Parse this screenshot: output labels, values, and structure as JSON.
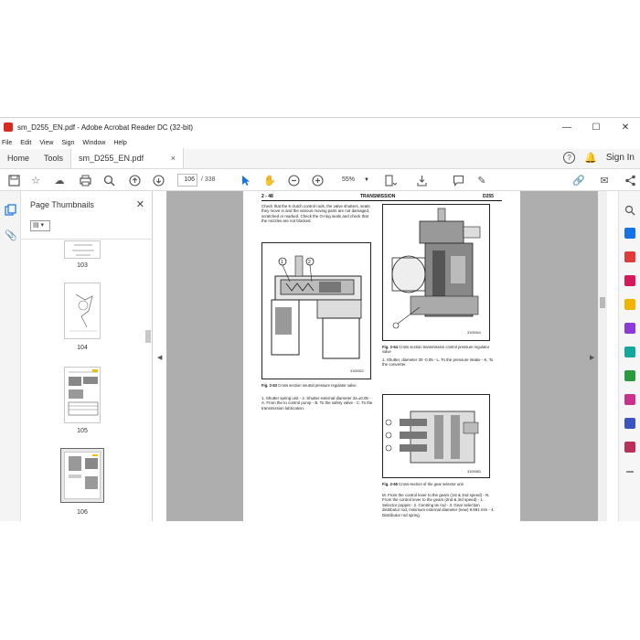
{
  "window": {
    "title": "sm_D255_EN.pdf - Adobe Acrobat Reader DC (32-bit)",
    "controls": [
      "—",
      "☐",
      "✕"
    ]
  },
  "menu": [
    "File",
    "Edit",
    "View",
    "Sign",
    "Window",
    "Help"
  ],
  "tabs": {
    "home": "Home",
    "tools": "Tools",
    "document": "sm_D255_EN.pdf",
    "close": "×",
    "help": "?",
    "sign_in": "Sign In"
  },
  "toolbar": {
    "page_current": "106",
    "page_total": "/ 338",
    "zoom": "55%"
  },
  "thumbnails": {
    "title": "Page Thumbnails",
    "close": "✕",
    "pages": [
      "103",
      "104",
      "105",
      "106"
    ]
  },
  "document": {
    "header_left": "2 - 48",
    "header_center": "TRANSMISSION",
    "header_right": "D255",
    "intro_text": "Check that the 5 clutch control rods, the valve shutters, seats they move in and the various moving parts are not damaged, scratched or marked. Check the O-ring seals and check that the nozzles are not blocked.",
    "fig63_caption_bold": "Fig. 2-63",
    "fig63_caption": "Cross section neutral pressure regulator valve.",
    "fig63_code": "3105922",
    "fig63_text": "1. Shutter spring unit - 2. Shutter external diameter 2a ±0.05 - A. From the to control pump - B. To the safety valve - C. To the transmission lubrication.",
    "fig64_caption_bold": "Fig. 2-64",
    "fig64_caption": "Cross section transmission control pressure regulator valve",
    "fig64_code": "3105944",
    "fig64_text": "1. Shutter, diameter 30 -0.05 - L. To the pressure intake - K. To the converter.",
    "fig65_caption_bold": "Fig. 2-65",
    "fig65_caption": "Cross-section of the gear selector unit",
    "fig65_code": "3105983",
    "fig65_text": "M. From the control lever to the gears (1st & 2nd speed) - N. From the control lever to the gears (2nd & 3rd speed) - 1. Selector poppet - 2. Centring tie rod - 3. Gear selection distributor rod, minimum external diameter (new) 9.991 mm - 4. Distributor rod spring."
  }
}
